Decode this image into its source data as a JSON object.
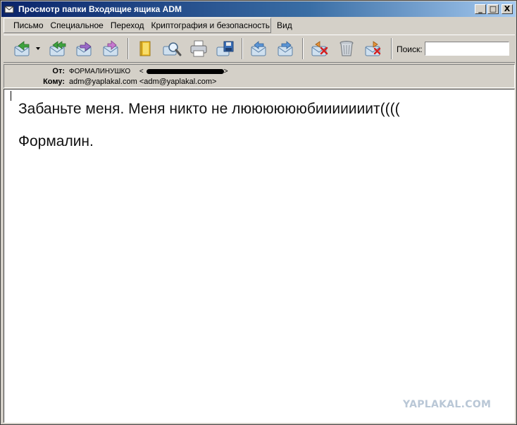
{
  "window": {
    "title": "Просмотр папки Входящие ящика ADM",
    "buttons": [
      "_",
      "□",
      "X"
    ]
  },
  "menu": {
    "items": [
      {
        "label": "Письмо",
        "icon": "none"
      },
      {
        "label": "Специальное"
      },
      {
        "label": "Переход"
      },
      {
        "label": "Криптография и безопасность"
      },
      {
        "label": "Вид"
      }
    ]
  },
  "toolbar": {
    "buttons": [
      {
        "icon": "reply-icon"
      },
      {
        "icon": "reply-dropdown-icon"
      },
      {
        "icon": "reply-all-icon"
      },
      {
        "icon": "forward-icon"
      },
      {
        "icon": "redirect-icon"
      },
      {
        "icon": "address-book-icon"
      },
      {
        "icon": "find-icon"
      },
      {
        "icon": "print-icon"
      },
      {
        "icon": "save-icon"
      },
      {
        "icon": "previous-icon"
      },
      {
        "icon": "next-icon"
      },
      {
        "icon": "delete-icon"
      },
      {
        "icon": "trash-icon"
      },
      {
        "icon": "junk-icon"
      }
    ],
    "search_label": "Поиск:",
    "search_value": ""
  },
  "headers": {
    "from_label": "От:",
    "from_value": "ФОРМАЛИНУШКО",
    "from_address_open": "<",
    "from_address_close": ">",
    "to_label": "Кому:",
    "to_value": "adm@yaplakal.com <adm@yaplakal.com>"
  },
  "message": {
    "line1": "Забаньте меня. Меня никто не лююююююбииииииит((((",
    "line2": "Формалин."
  },
  "watermark": "YAPLAKAL.COM",
  "colors": {
    "titlebar_start": "#0a246a",
    "titlebar_end": "#a6caf0",
    "chrome": "#d4d0c8"
  }
}
